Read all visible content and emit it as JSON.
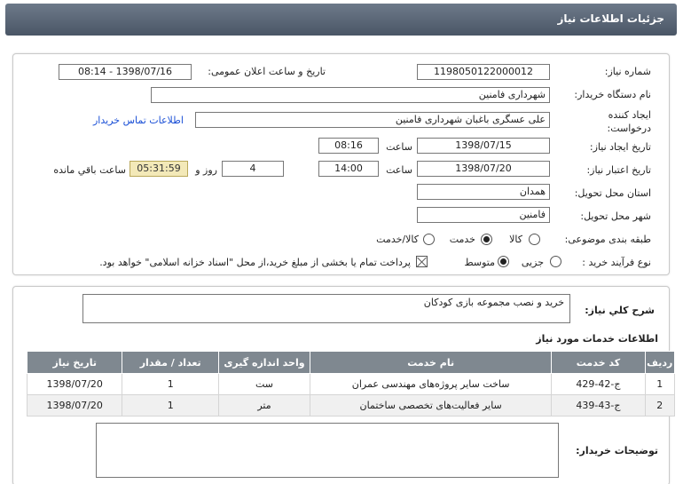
{
  "header": {
    "title": "جزئیات اطلاعات نیاز"
  },
  "labels": {
    "need_number": "شماره نیاز:",
    "announce_datetime": "تاریخ و ساعت اعلان عمومی:",
    "buyer_org": "نام دستگاه خریدار:",
    "requester_line1": "ایجاد کننده",
    "requester_line2": "درخواست:",
    "created_date": "تاریخ ایجاد نیاز:",
    "validity_date": "تاریخ اعتبار نیاز:",
    "hour": "ساعت",
    "day_and": "روز و",
    "remaining": "ساعت باقي مانده",
    "province": "استان محل تحویل:",
    "city": "شهر محل تحویل:",
    "category": "طبقه بندی موضوعی:",
    "process": "نوع فرآیند خرید :",
    "general_desc": "شرح کلي نیاز:",
    "services_title": "اطلاعات خدمات مورد نیاز",
    "buyer_notes": "توضیحات خریدار:"
  },
  "fields": {
    "need_number": "1198050122000012",
    "announce_datetime": "1398/07/16 - 08:14",
    "buyer_org": "شهرداری فامنین",
    "requester": "علی عسگری باغبان شهرداری فامنین",
    "contact_link": "اطلاعات تماس خریدار",
    "created_date": "1398/07/15",
    "created_time": "08:16",
    "validity_date": "1398/07/20",
    "validity_time": "14:00",
    "days_left": "4",
    "time_left": "05:31:59",
    "province": "همدان",
    "city": "فامنین",
    "general_desc": "خرید و نصب مجموعه بازی کودکان",
    "buyer_notes": ""
  },
  "category_options": [
    {
      "label": "کالا",
      "selected": false
    },
    {
      "label": "خدمت",
      "selected": true
    },
    {
      "label": "کالا/خدمت",
      "selected": false
    }
  ],
  "process_options": [
    {
      "label": "جزیی",
      "selected": false
    },
    {
      "label": "متوسط",
      "selected": true
    }
  ],
  "treasury_note": "پرداخت تمام یا بخشی از مبلغ خرید،از محل \"اسناد خزانه اسلامی\" خواهد بود.",
  "table": {
    "headers": [
      "ردیف",
      "کد خدمت",
      "نام خدمت",
      "واحد اندازه گیری",
      "تعداد / مقدار",
      "تاریخ نیاز"
    ],
    "rows": [
      [
        "1",
        "ج-42-429",
        "ساخت سایر پروژه‌های مهندسی عمران",
        "ست",
        "1",
        "1398/07/20"
      ],
      [
        "2",
        "ج-43-439",
        "سایر فعالیت‌های تخصصی ساختمان",
        "متر",
        "1",
        "1398/07/20"
      ]
    ]
  }
}
